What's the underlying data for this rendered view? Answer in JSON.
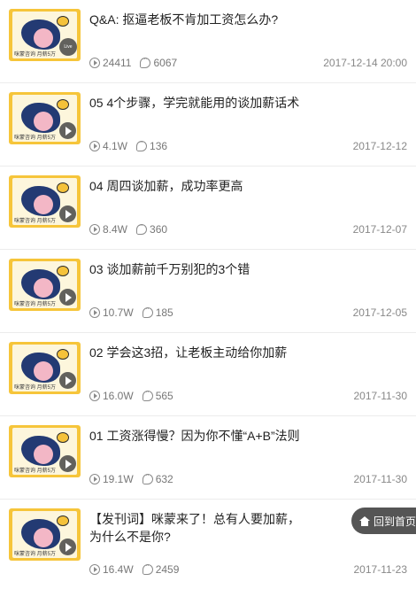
{
  "items": [
    {
      "title": "Q&A: 抠逼老板不肯加工资怎么办?",
      "plays": "24411",
      "comments": "6067",
      "date": "2017-12-14 20:00",
      "badge": "live",
      "thumb_label": "咪蒙咨询  月薪5万"
    },
    {
      "title": "05 4个步骤，学完就能用的谈加薪话术",
      "plays": "4.1W",
      "comments": "136",
      "date": "2017-12-12",
      "badge": "play",
      "thumb_label": "咪蒙咨询  月薪5万"
    },
    {
      "title": "04 周四谈加薪，成功率更高",
      "plays": "8.4W",
      "comments": "360",
      "date": "2017-12-07",
      "badge": "play",
      "thumb_label": "咪蒙咨询  月薪5万"
    },
    {
      "title": "03 谈加薪前千万别犯的3个错",
      "plays": "10.7W",
      "comments": "185",
      "date": "2017-12-05",
      "badge": "play",
      "thumb_label": "咪蒙咨询  月薪5万"
    },
    {
      "title": "02 学会这3招，让老板主动给你加薪",
      "plays": "16.0W",
      "comments": "565",
      "date": "2017-11-30",
      "badge": "play",
      "thumb_label": "咪蒙咨询  月薪5万"
    },
    {
      "title": "01 工资涨得慢？因为你不懂“A+B”法则",
      "plays": "19.1W",
      "comments": "632",
      "date": "2017-11-30",
      "badge": "play",
      "thumb_label": "咪蒙咨询  月薪5万"
    },
    {
      "title": "【发刊词】咪蒙来了！总有人要加薪，为什么不是你?",
      "plays": "16.4W",
      "comments": "2459",
      "date": "2017-11-23",
      "badge": "play",
      "thumb_label": "咪蒙咨询  月薪5万"
    }
  ],
  "live_badge_text": "Live",
  "back_home_label": "回到首页",
  "colors": {
    "thumb_bg": "#f6c53a",
    "back_button_bg": "#555555"
  }
}
